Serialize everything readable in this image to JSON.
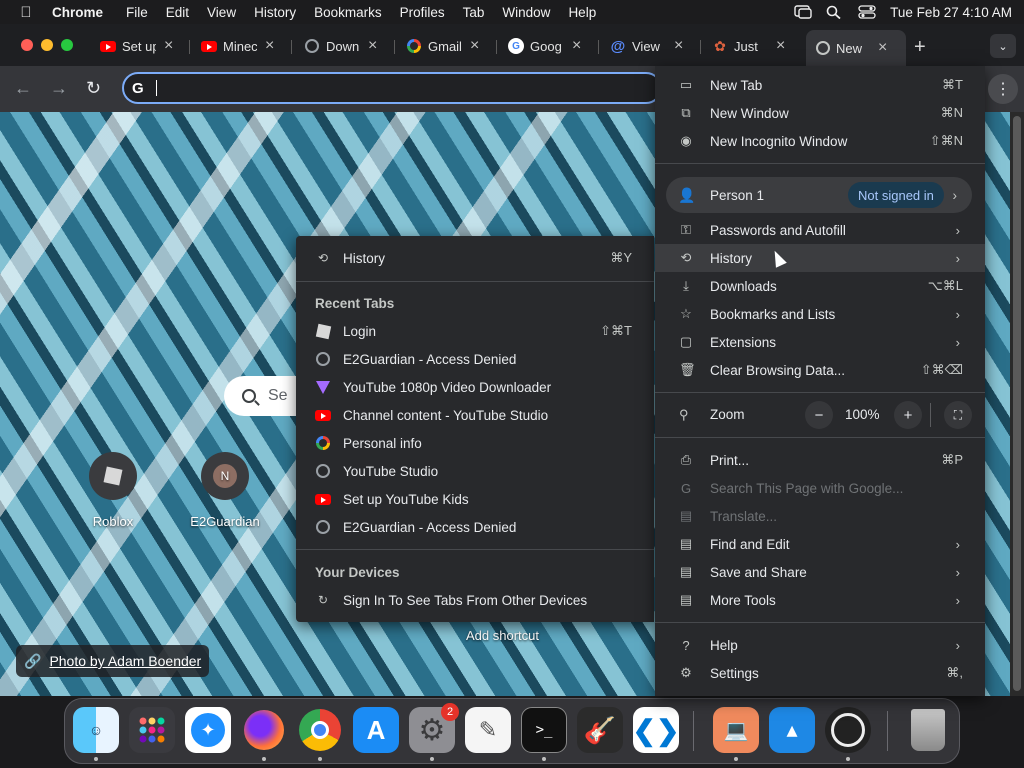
{
  "menubar": {
    "app": "Chrome",
    "items": [
      "File",
      "Edit",
      "View",
      "History",
      "Bookmarks",
      "Profiles",
      "Tab",
      "Window",
      "Help"
    ],
    "clock": "Tue Feb 27  4:10 AM"
  },
  "tabs": [
    {
      "title": "Set up",
      "icon": "youtube-icon"
    },
    {
      "title": "Minec",
      "icon": "youtube-icon"
    },
    {
      "title": "Down",
      "icon": "globe-icon"
    },
    {
      "title": "Gmail",
      "icon": "google-icon"
    },
    {
      "title": "Goog",
      "icon": "google-icon"
    },
    {
      "title": "View",
      "icon": "at-icon"
    },
    {
      "title": "Just",
      "icon": "script-icon"
    },
    {
      "title": "New",
      "icon": "chrome-icon",
      "active": true
    }
  ],
  "omnibox": {
    "value": "",
    "prefix": "G"
  },
  "page": {
    "search_placeholder": "Se",
    "shortcuts": [
      {
        "label": "Roblox",
        "initial": ""
      },
      {
        "label": "E2Guardian",
        "initial": "N"
      }
    ],
    "add_shortcut": "Add shortcut",
    "photo_credit": "Photo by Adam Boender"
  },
  "main_menu": {
    "new_tab": {
      "label": "New Tab",
      "shortcut": "⌘T"
    },
    "new_window": {
      "label": "New Window",
      "shortcut": "⌘N"
    },
    "new_incognito": {
      "label": "New Incognito Window",
      "shortcut": "⇧⌘N"
    },
    "person": {
      "label": "Person 1",
      "badge": "Not signed in"
    },
    "passwords": {
      "label": "Passwords and Autofill"
    },
    "history": {
      "label": "History"
    },
    "downloads": {
      "label": "Downloads",
      "shortcut": "⌥⌘L"
    },
    "bookmarks": {
      "label": "Bookmarks and Lists"
    },
    "extensions": {
      "label": "Extensions"
    },
    "clear_data": {
      "label": "Clear Browsing Data...",
      "shortcut": "⇧⌘⌫"
    },
    "zoom": {
      "label": "Zoom",
      "value": "100%"
    },
    "print": {
      "label": "Print...",
      "shortcut": "⌘P"
    },
    "search_page": {
      "label": "Search This Page with Google..."
    },
    "translate": {
      "label": "Translate..."
    },
    "find_edit": {
      "label": "Find and Edit"
    },
    "save_share": {
      "label": "Save and Share"
    },
    "more_tools": {
      "label": "More Tools"
    },
    "help": {
      "label": "Help"
    },
    "settings": {
      "label": "Settings",
      "shortcut": "⌘,"
    }
  },
  "history_menu": {
    "history": {
      "label": "History",
      "shortcut": "⌘Y"
    },
    "recent_tabs_heading": "Recent Tabs",
    "recent": [
      {
        "label": "Login",
        "shortcut": "⇧⌘T",
        "icon": "roblox-icon"
      },
      {
        "label": "E2Guardian - Access Denied",
        "icon": "globe-icon"
      },
      {
        "label": "YouTube 1080p Video Downloader",
        "icon": "triangle-icon"
      },
      {
        "label": "Channel content - YouTube Studio",
        "icon": "youtube-icon"
      },
      {
        "label": "Personal info",
        "icon": "google-icon"
      },
      {
        "label": "YouTube Studio",
        "icon": "globe-icon"
      },
      {
        "label": "Set up YouTube Kids",
        "icon": "youtube-icon"
      },
      {
        "label": "E2Guardian - Access Denied",
        "icon": "globe-icon"
      }
    ],
    "devices_heading": "Your Devices",
    "sign_in": "Sign In To See Tabs From Other Devices"
  },
  "dock": {
    "apps": [
      "Finder",
      "Launchpad",
      "Safari",
      "Firefox",
      "Chrome",
      "App Store",
      "System Settings",
      "TextEdit",
      "Terminal",
      "GarageBand",
      "VS Code",
      "Remote Desktop",
      "Keynote",
      "OBS",
      "Trash"
    ],
    "notification": "2"
  },
  "colors": {
    "accent": "#7cacf8",
    "menu_bg": "#28292c",
    "badge_bg": "#1a3a4f",
    "badge_fg": "#a8c7fa"
  }
}
